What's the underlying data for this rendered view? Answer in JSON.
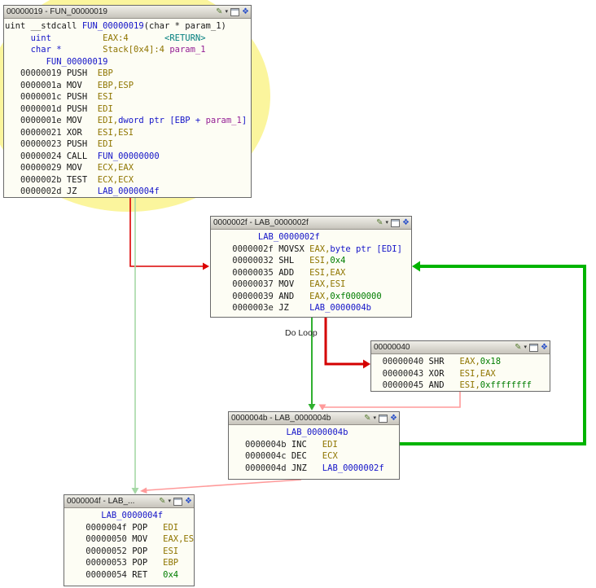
{
  "edge_label": "Do Loop",
  "colors": {
    "highlight": "#fbf59d",
    "edge_jump": "#dc0000",
    "edge_jump_highlight": "#d40000",
    "edge_fallthrough": "#30b030",
    "edge_fallthrough_pale": "#a6d8a6",
    "edge_back_pale": "#ff9a9a",
    "edge_loop_highlight": "#00b400"
  },
  "blocks": [
    {
      "title": "00000019 - FUN_00000019",
      "lines": [
        {
          "tokens": [
            {
              "t": "uint __stdcall ",
              "c": "plain"
            },
            {
              "t": "FUN_00000019",
              "c": "lbl"
            },
            {
              "t": "(char * param_1)",
              "c": "plain"
            }
          ]
        },
        {
          "tokens": [
            {
              "t": "     ",
              "c": "plain"
            },
            {
              "t": "uint",
              "c": "type"
            },
            {
              "t": "          ",
              "c": "plain"
            },
            {
              "t": "EAX:4",
              "c": "reg"
            },
            {
              "t": "       ",
              "c": "plain"
            },
            {
              "t": "<RETURN>",
              "c": "ret"
            }
          ]
        },
        {
          "tokens": [
            {
              "t": "     ",
              "c": "plain"
            },
            {
              "t": "char *",
              "c": "type"
            },
            {
              "t": "        ",
              "c": "plain"
            },
            {
              "t": "Stack[0x4]:4",
              "c": "reg"
            },
            {
              "t": " ",
              "c": "plain"
            },
            {
              "t": "param_1",
              "c": "param"
            }
          ]
        },
        {
          "tokens": [
            {
              "t": "        ",
              "c": "plain"
            },
            {
              "t": "FUN_00000019",
              "c": "lbl"
            }
          ]
        },
        {
          "tokens": [
            {
              "t": "   00000019 ",
              "c": "addr"
            },
            {
              "t": "PUSH  ",
              "c": "mnem"
            },
            {
              "t": "EBP",
              "c": "reg"
            }
          ]
        },
        {
          "tokens": [
            {
              "t": "   0000001a ",
              "c": "addr"
            },
            {
              "t": "MOV   ",
              "c": "mnem"
            },
            {
              "t": "EBP,ESP",
              "c": "reg"
            }
          ]
        },
        {
          "tokens": [
            {
              "t": "   0000001c ",
              "c": "addr"
            },
            {
              "t": "PUSH  ",
              "c": "mnem"
            },
            {
              "t": "ESI",
              "c": "reg"
            }
          ]
        },
        {
          "tokens": [
            {
              "t": "   0000001d ",
              "c": "addr"
            },
            {
              "t": "PUSH  ",
              "c": "mnem"
            },
            {
              "t": "EDI",
              "c": "reg"
            }
          ]
        },
        {
          "tokens": [
            {
              "t": "   0000001e ",
              "c": "addr"
            },
            {
              "t": "MOV   ",
              "c": "mnem"
            },
            {
              "t": "EDI,",
              "c": "reg"
            },
            {
              "t": "dword ptr ",
              "c": "ref"
            },
            {
              "t": "[EBP + ",
              "c": "ref"
            },
            {
              "t": "param_1",
              "c": "param"
            },
            {
              "t": "]",
              "c": "ref"
            }
          ]
        },
        {
          "tokens": [
            {
              "t": "   00000021 ",
              "c": "addr"
            },
            {
              "t": "XOR   ",
              "c": "mnem"
            },
            {
              "t": "ESI,ESI",
              "c": "reg"
            }
          ]
        },
        {
          "tokens": [
            {
              "t": "   00000023 ",
              "c": "addr"
            },
            {
              "t": "PUSH  ",
              "c": "mnem"
            },
            {
              "t": "EDI",
              "c": "reg"
            }
          ]
        },
        {
          "tokens": [
            {
              "t": "   00000024 ",
              "c": "addr"
            },
            {
              "t": "CALL  ",
              "c": "mnem"
            },
            {
              "t": "FUN_00000000",
              "c": "lbl"
            }
          ]
        },
        {
          "tokens": [
            {
              "t": "   00000029 ",
              "c": "addr"
            },
            {
              "t": "MOV   ",
              "c": "mnem"
            },
            {
              "t": "ECX,EAX",
              "c": "reg"
            }
          ]
        },
        {
          "tokens": [
            {
              "t": "   0000002b ",
              "c": "addr"
            },
            {
              "t": "TEST  ",
              "c": "mnem"
            },
            {
              "t": "ECX,ECX",
              "c": "reg"
            }
          ]
        },
        {
          "tokens": [
            {
              "t": "   0000002d ",
              "c": "addr"
            },
            {
              "t": "JZ    ",
              "c": "mnem"
            },
            {
              "t": "LAB_0000004f",
              "c": "lbl"
            }
          ]
        }
      ]
    },
    {
      "title": "0000002f - LAB_0000002f",
      "lines": [
        {
          "tokens": [
            {
              "t": "         ",
              "c": "plain"
            },
            {
              "t": "LAB_0000002f",
              "c": "lbl"
            }
          ]
        },
        {
          "tokens": [
            {
              "t": "    0000002f ",
              "c": "addr"
            },
            {
              "t": "MOVSX ",
              "c": "mnem"
            },
            {
              "t": "EAX,",
              "c": "reg"
            },
            {
              "t": "byte ptr ",
              "c": "ref"
            },
            {
              "t": "[EDI]",
              "c": "ref"
            }
          ]
        },
        {
          "tokens": [
            {
              "t": "    00000032 ",
              "c": "addr"
            },
            {
              "t": "SHL   ",
              "c": "mnem"
            },
            {
              "t": "ESI,",
              "c": "reg"
            },
            {
              "t": "0x4",
              "c": "const"
            }
          ]
        },
        {
          "tokens": [
            {
              "t": "    00000035 ",
              "c": "addr"
            },
            {
              "t": "ADD   ",
              "c": "mnem"
            },
            {
              "t": "ESI,EAX",
              "c": "reg"
            }
          ]
        },
        {
          "tokens": [
            {
              "t": "    00000037 ",
              "c": "addr"
            },
            {
              "t": "MOV   ",
              "c": "mnem"
            },
            {
              "t": "EAX,ESI",
              "c": "reg"
            }
          ]
        },
        {
          "tokens": [
            {
              "t": "    00000039 ",
              "c": "addr"
            },
            {
              "t": "AND   ",
              "c": "mnem"
            },
            {
              "t": "EAX,",
              "c": "reg"
            },
            {
              "t": "0xf0000000",
              "c": "const"
            }
          ]
        },
        {
          "tokens": [
            {
              "t": "    0000003e ",
              "c": "addr"
            },
            {
              "t": "JZ    ",
              "c": "mnem"
            },
            {
              "t": "LAB_0000004b",
              "c": "lbl"
            }
          ]
        }
      ]
    },
    {
      "title": "00000040",
      "lines": [
        {
          "tokens": [
            {
              "t": "  00000040 ",
              "c": "addr"
            },
            {
              "t": "SHR   ",
              "c": "mnem"
            },
            {
              "t": "EAX,",
              "c": "reg"
            },
            {
              "t": "0x18",
              "c": "const"
            }
          ]
        },
        {
          "tokens": [
            {
              "t": "  00000043 ",
              "c": "addr"
            },
            {
              "t": "XOR   ",
              "c": "mnem"
            },
            {
              "t": "ESI,EAX",
              "c": "reg"
            }
          ]
        },
        {
          "tokens": [
            {
              "t": "  00000045 ",
              "c": "addr"
            },
            {
              "t": "AND   ",
              "c": "mnem"
            },
            {
              "t": "ESI,",
              "c": "reg"
            },
            {
              "t": "0xffffffff",
              "c": "const"
            }
          ]
        }
      ]
    },
    {
      "title": "0000004b - LAB_0000004b",
      "lines": [
        {
          "tokens": [
            {
              "t": "           ",
              "c": "plain"
            },
            {
              "t": "LAB_0000004b",
              "c": "lbl"
            }
          ]
        },
        {
          "tokens": [
            {
              "t": "   0000004b ",
              "c": "addr"
            },
            {
              "t": "INC   ",
              "c": "mnem"
            },
            {
              "t": "EDI",
              "c": "reg"
            }
          ]
        },
        {
          "tokens": [
            {
              "t": "   0000004c ",
              "c": "addr"
            },
            {
              "t": "DEC   ",
              "c": "mnem"
            },
            {
              "t": "ECX",
              "c": "reg"
            }
          ]
        },
        {
          "tokens": [
            {
              "t": "   0000004d ",
              "c": "addr"
            },
            {
              "t": "JNZ   ",
              "c": "mnem"
            },
            {
              "t": "LAB_0000002f",
              "c": "lbl"
            }
          ]
        }
      ]
    },
    {
      "title": "0000004f - LAB_...",
      "lines": [
        {
          "tokens": [
            {
              "t": "       ",
              "c": "plain"
            },
            {
              "t": "LAB_0000004f",
              "c": "lbl"
            }
          ]
        },
        {
          "tokens": [
            {
              "t": "    0000004f ",
              "c": "addr"
            },
            {
              "t": "POP   ",
              "c": "mnem"
            },
            {
              "t": "EDI",
              "c": "reg"
            }
          ]
        },
        {
          "tokens": [
            {
              "t": "    00000050 ",
              "c": "addr"
            },
            {
              "t": "MOV   ",
              "c": "mnem"
            },
            {
              "t": "EAX,ESI",
              "c": "reg"
            }
          ]
        },
        {
          "tokens": [
            {
              "t": "    00000052 ",
              "c": "addr"
            },
            {
              "t": "POP   ",
              "c": "mnem"
            },
            {
              "t": "ESI",
              "c": "reg"
            }
          ]
        },
        {
          "tokens": [
            {
              "t": "    00000053 ",
              "c": "addr"
            },
            {
              "t": "POP   ",
              "c": "mnem"
            },
            {
              "t": "EBP",
              "c": "reg"
            }
          ]
        },
        {
          "tokens": [
            {
              "t": "    00000054 ",
              "c": "addr"
            },
            {
              "t": "RET   ",
              "c": "mnem"
            },
            {
              "t": "0x4",
              "c": "const"
            }
          ]
        }
      ]
    }
  ]
}
